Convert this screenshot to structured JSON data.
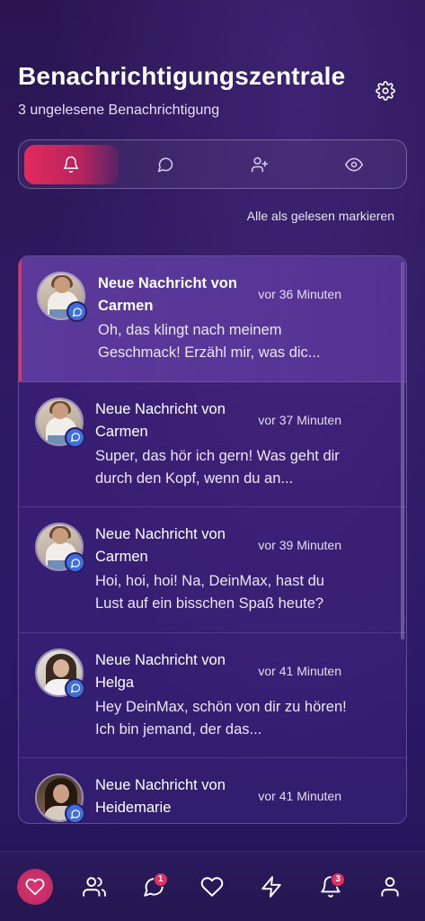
{
  "header": {
    "title": "Benachrichtigungszentrale",
    "subtitle": "3 ungelesene Benachrichtigung"
  },
  "tabs": [
    {
      "icon": "bell-icon",
      "active": true
    },
    {
      "icon": "chat-icon",
      "active": false
    },
    {
      "icon": "user-plus-icon",
      "active": false
    },
    {
      "icon": "eye-icon",
      "active": false
    }
  ],
  "mark_all_label": "Alle als gelesen markieren",
  "notifications": [
    {
      "title": "Neue Nachricht von Carmen",
      "time": "vor 36 Minuten",
      "preview": "Oh, das klingt nach meinem Geschmack! Erzähl mir, was dic...",
      "unread": true,
      "avatar": "carmen"
    },
    {
      "title": "Neue Nachricht von Carmen",
      "time": "vor 37 Minuten",
      "preview": "Super, das hör ich gern! Was geht dir durch den Kopf, wenn du an...",
      "unread": false,
      "avatar": "carmen"
    },
    {
      "title": "Neue Nachricht von Carmen",
      "time": "vor 39 Minuten",
      "preview": "Hoi, hoi, hoi! Na, DeinMax, hast du Lust auf ein bisschen Spaß heute?",
      "unread": false,
      "avatar": "carmen"
    },
    {
      "title": "Neue Nachricht von Helga",
      "time": "vor 41 Minuten",
      "preview": "Hey DeinMax, schön von dir zu hören! Ich bin jemand, der das...",
      "unread": false,
      "avatar": "helga"
    },
    {
      "title": "Neue Nachricht von Heidemarie",
      "time": "vor 41 Minuten",
      "preview": "",
      "unread": false,
      "avatar": "heidemarie"
    }
  ],
  "bottom_nav": {
    "items": [
      {
        "icon": "heart-icon",
        "active": true
      },
      {
        "icon": "users-icon"
      },
      {
        "icon": "chat-icon",
        "badge": "1"
      },
      {
        "icon": "heart-outline-icon"
      },
      {
        "icon": "bolt-icon"
      },
      {
        "icon": "bell-icon",
        "badge": "3"
      },
      {
        "icon": "profile-icon"
      }
    ]
  },
  "colors": {
    "accent": "#e2295e",
    "background": "#2a1551",
    "badge_blue": "#3f6fdc"
  }
}
